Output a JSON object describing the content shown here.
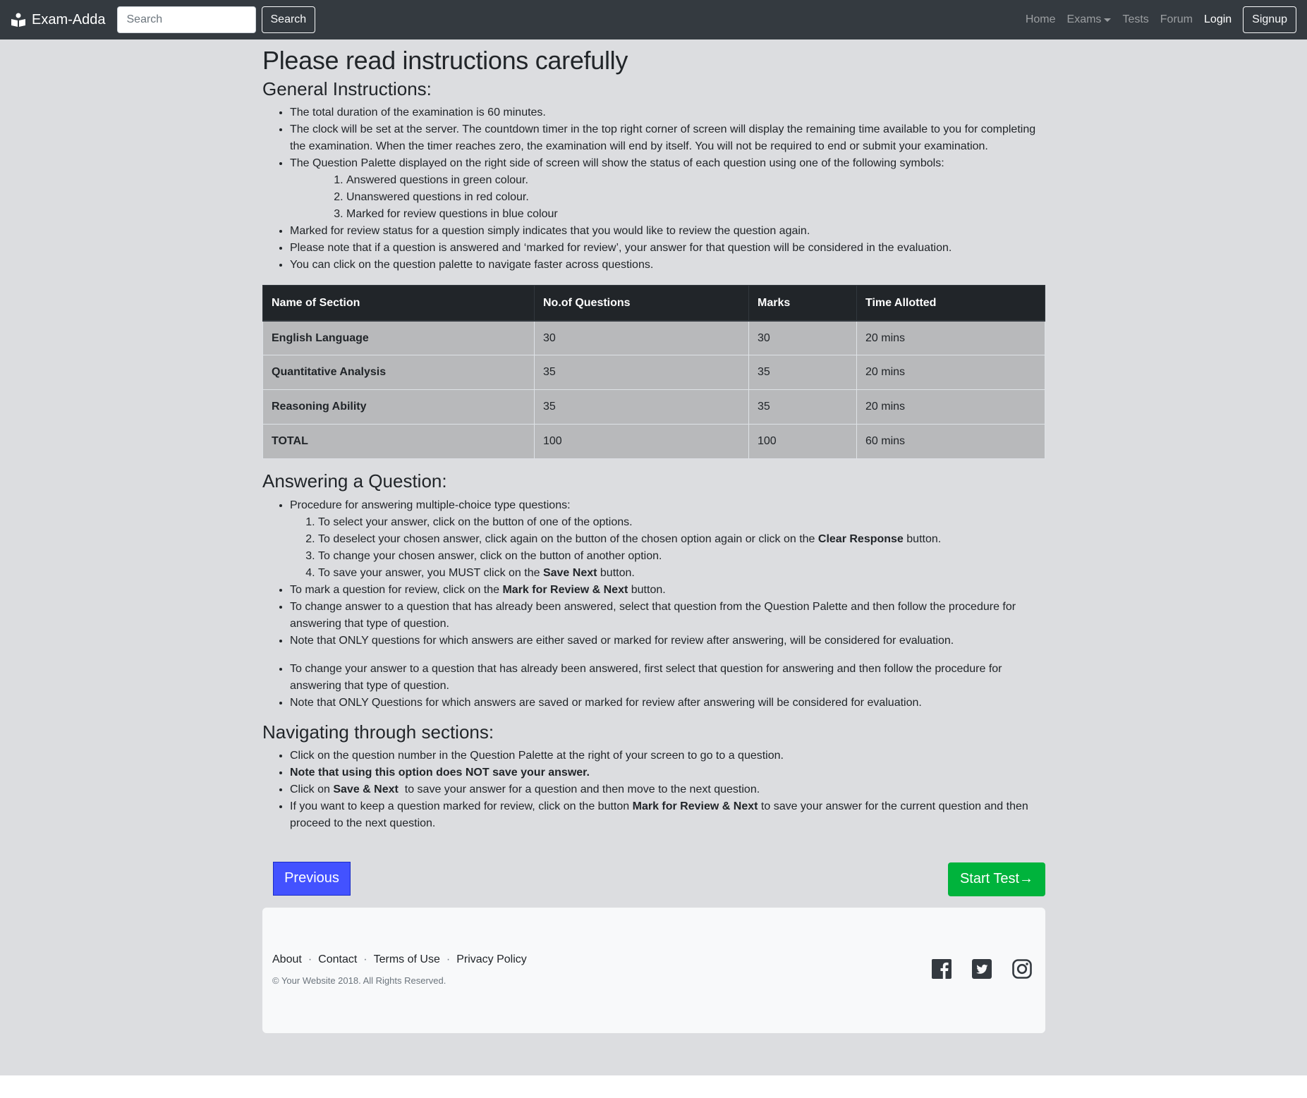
{
  "navbar": {
    "brand": "Exam-Adda",
    "search_placeholder": "Search",
    "search_button": "Search",
    "links": {
      "home": "Home",
      "exams": "Exams",
      "tests": "Tests",
      "forum": "Forum",
      "login": "Login",
      "signup": "Signup"
    }
  },
  "page": {
    "title": "Please read instructions carefully"
  },
  "general": {
    "heading": "General Instructions:",
    "items": [
      "The total duration of the examination is 60 minutes.",
      "The clock will be set at the server. The countdown timer in the top right corner of screen will display the remaining time available to you for completing the examination. When the timer reaches zero, the examination will end by itself. You will not be required to end or submit your examination.",
      "The Question Palette displayed on the right side of screen will show the status of each question using one of the following symbols:",
      "Marked for review status for a question simply indicates that you would like to review the question again.",
      "Please note that if a question is answered and ‘marked for review’, your answer for that question will be considered in the evaluation.",
      "You can click on the question palette to navigate faster across questions."
    ],
    "symbols": [
      "Answered questions in green colour.",
      "Unanswered questions in red colour.",
      "Marked for review questions in blue colour"
    ]
  },
  "table": {
    "headers": [
      "Name of Section",
      "No.of Questions",
      "Marks",
      "Time Allotted"
    ],
    "rows": [
      [
        "English Language",
        "30",
        "30",
        "20 mins"
      ],
      [
        "Quantitative Analysis",
        "35",
        "35",
        "20 mins"
      ],
      [
        "Reasoning Ability",
        "35",
        "35",
        "20 mins"
      ],
      [
        "TOTAL",
        "100",
        "100",
        "60 mins"
      ]
    ]
  },
  "answering": {
    "heading": "Answering a Question:",
    "procedure_intro": "Procedure for answering multiple-choice type questions:",
    "steps": {
      "s1": "To select your answer, click on the button of one of the options.",
      "s2_pre": "To deselect your chosen answer, click again on the button of the chosen option again or click on the ",
      "s2_bold": "Clear Response",
      "s2_post": " button.",
      "s3": "To change your chosen answer, click on the button of another option.",
      "s4_pre": "To save your answer, you MUST click on the ",
      "s4_bold": "Save Next",
      "s4_post": " button."
    },
    "mark_pre": "To mark a question for review, click on the ",
    "mark_bold": "Mark for Review & Next",
    "mark_post": " button.",
    "change": "To change answer to a question that has already been answered, select that question from the Question Palette and then follow the procedure for answering that type of question.",
    "note": "Note that ONLY questions for which answers are either saved or marked for review after answering, will be considered for evaluation.",
    "change2": "To change your answer to a question that has already been answered, first select that question for answering and then follow the procedure for answering that type of question.",
    "note2": "Note that ONLY Questions for which answers are saved or marked for review after answering will be considered for evaluation."
  },
  "navigating": {
    "heading": "Navigating through sections:",
    "i1": "Click on the question number in the Question Palette at the right of your screen to go to a question.",
    "i2": "Note that using this option does NOT save your answer.",
    "i3_pre": "Click on ",
    "i3_bold": "Save & Next",
    "i3_post": "  to save your answer for a question and then move to the next question.",
    "i4_pre": "If you want to keep a question marked for review, click on the button ",
    "i4_bold": "Mark for Review & Next",
    "i4_post": " to save your answer for the current question and then proceed to the next question."
  },
  "buttons": {
    "previous": "Previous",
    "start": "Start Test→"
  },
  "footer": {
    "links": [
      "About",
      "Contact",
      "Terms of Use",
      "Privacy Policy"
    ],
    "separator": "·",
    "copyright": "© Your Website 2018. All Rights Reserved.",
    "social_icons": [
      "facebook-icon",
      "twitter-icon",
      "instagram-icon"
    ]
  },
  "colors": {
    "navbar": "#343a40",
    "page_bg": "#dcdde0",
    "table_head": "#212529",
    "table_cell": "#b8b9bb",
    "previous_button": "#4352ff",
    "start_button": "#00b33c"
  }
}
